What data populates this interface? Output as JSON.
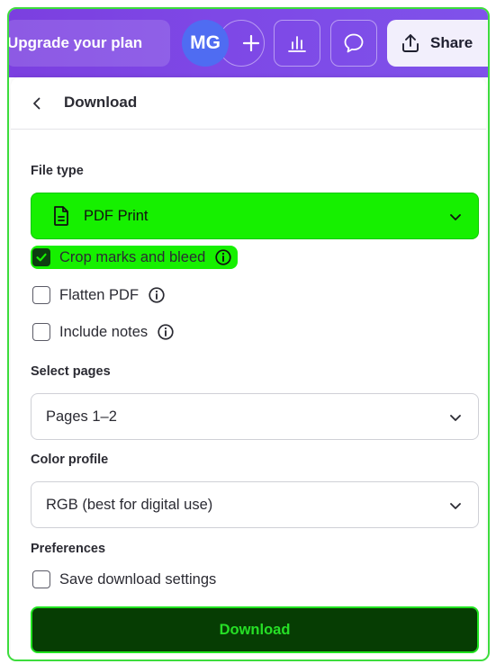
{
  "topbar": {
    "upgrade_label": "Upgrade your plan",
    "avatar_initials": "MG",
    "share_label": "Share"
  },
  "panel": {
    "title": "Download",
    "file_type": {
      "label": "File type",
      "selected": "PDF Print"
    },
    "options": {
      "crop_marks": {
        "label": "Crop marks and bleed",
        "checked": true
      },
      "flatten_pdf": {
        "label": "Flatten PDF",
        "checked": false
      },
      "include_notes": {
        "label": "Include notes",
        "checked": false
      }
    },
    "select_pages": {
      "label": "Select pages",
      "selected": "Pages 1–2"
    },
    "color_profile": {
      "label": "Color profile",
      "selected": "RGB (best for digital use)"
    },
    "preferences": {
      "label": "Preferences",
      "save_settings": {
        "label": "Save download settings",
        "checked": false
      }
    },
    "download_label": "Download"
  },
  "colors": {
    "header_gradient_start": "#7b3fe0",
    "header_gradient_end": "#7f52ea",
    "avatar": "#4f6cf2",
    "highlight_green": "#16f000",
    "download_bg": "#063d03",
    "download_text": "#26e026"
  }
}
